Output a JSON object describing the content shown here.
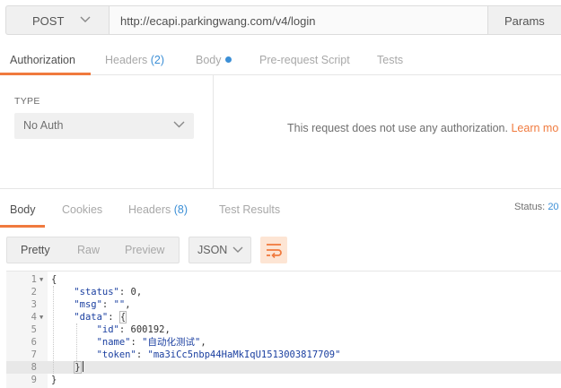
{
  "request": {
    "method": "POST",
    "url": "http://ecapi.parkingwang.com/v4/login",
    "params_label": "Params"
  },
  "request_tabs": [
    {
      "label": "Authorization",
      "active": true
    },
    {
      "label": "Headers",
      "count": "(2)"
    },
    {
      "label": "Body",
      "has_dot": true
    },
    {
      "label": "Pre-request Script"
    },
    {
      "label": "Tests"
    }
  ],
  "auth": {
    "type_label": "TYPE",
    "selected": "No Auth",
    "message": "This request does not use any authorization.",
    "learn_more": "Learn mo"
  },
  "response_tabs": [
    {
      "label": "Body",
      "active": true
    },
    {
      "label": "Cookies"
    },
    {
      "label": "Headers",
      "count": "(8)"
    },
    {
      "label": "Test Results"
    }
  ],
  "status": {
    "label": "Status:",
    "value": "20"
  },
  "view_modes": [
    "Pretty",
    "Raw",
    "Preview"
  ],
  "format": "JSON",
  "code_lines": [
    {
      "n": "1",
      "fold": true
    },
    {
      "n": "2"
    },
    {
      "n": "3"
    },
    {
      "n": "4",
      "fold": true
    },
    {
      "n": "5"
    },
    {
      "n": "6"
    },
    {
      "n": "7"
    },
    {
      "n": "8",
      "highlight": true
    },
    {
      "n": "9"
    }
  ],
  "json": {
    "open": "{",
    "status_key": "\"status\"",
    "status_val": "0",
    "msg_key": "\"msg\"",
    "msg_val": "\"\"",
    "data_key": "\"data\"",
    "data_open": "{",
    "id_key": "\"id\"",
    "id_val": "600192",
    "name_key": "\"name\"",
    "name_val": "\"自动化测试\"",
    "token_key": "\"token\"",
    "token_val": "\"ma3iCc5nbp44HaMkIqU1513003817709\"",
    "data_close": "}",
    "close": "}"
  }
}
